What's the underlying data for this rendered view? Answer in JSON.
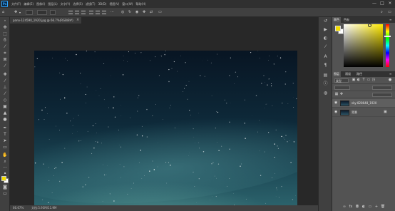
{
  "app": {
    "logo_text": "Ps"
  },
  "menu": {
    "items": [
      {
        "label": "文件(F)"
      },
      {
        "label": "编辑(E)"
      },
      {
        "label": "图像(I)"
      },
      {
        "label": "图层(L)"
      },
      {
        "label": "文字(Y)"
      },
      {
        "label": "选择(S)"
      },
      {
        "label": "滤镜(T)"
      },
      {
        "label": "3D(D)"
      },
      {
        "label": "视图(V)"
      },
      {
        "label": "窗口(W)"
      },
      {
        "label": "帮助(H)"
      }
    ]
  },
  "window_buttons": {
    "minimize": "—",
    "restore": "□",
    "close": "×"
  },
  "options_bar": {
    "tool_icon": "move-icon",
    "home_icon": "home-icon"
  },
  "document": {
    "tab_title": "pano-124590_1920.jpg @ 66.7%(RGB/8#)",
    "tab_close": "×"
  },
  "status_bar": {
    "zoom": "66.67%",
    "doc_info": "文档:5.93M/11.9M"
  },
  "color_panel": {
    "tabs": [
      {
        "label": "颜色",
        "active": true
      },
      {
        "label": "色板",
        "active": false
      }
    ],
    "foreground": "#f3dd00",
    "background": "#ffffff"
  },
  "layers_panel": {
    "tabs": [
      {
        "label": "图层",
        "active": true
      },
      {
        "label": "通道",
        "active": false
      },
      {
        "label": "路径",
        "active": false
      }
    ],
    "kind_filter": "类型",
    "layers": [
      {
        "name": "sky-828648_1920",
        "visible": true,
        "selected": true
      },
      {
        "name": "背景",
        "visible": true,
        "selected": false,
        "locked": true
      }
    ]
  },
  "colors": {
    "app_dark": "#303030",
    "panel": "#535353",
    "toolbar": "#404040",
    "accent": "#31a8ff"
  }
}
